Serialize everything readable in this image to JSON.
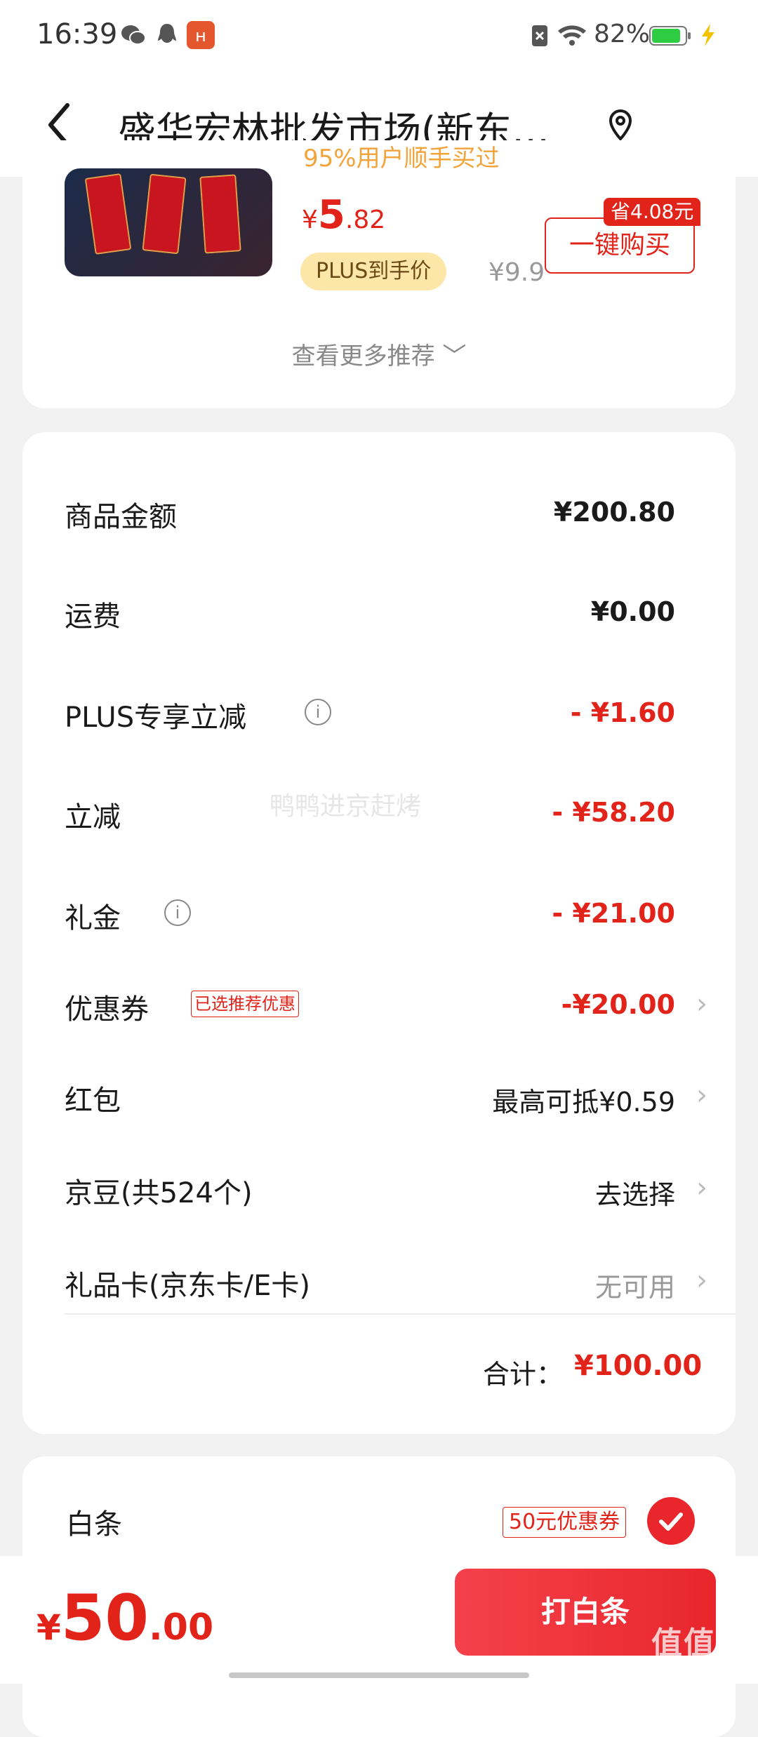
{
  "status_bar": {
    "time": "16:39",
    "battery": "82%"
  },
  "header": {
    "title": "盛华宏林批发市场(新东…"
  },
  "recommend": {
    "sub_text": "95%用户顺手买过",
    "price_symbol": "¥",
    "price_int": "5",
    "price_dec": ".82",
    "plus_label": "PLUS到手价",
    "original_price": "¥9.9",
    "save_badge": "省4.08元",
    "buy_button": "一键购买",
    "more_link": "查看更多推荐 ﹀"
  },
  "price_detail": {
    "rows": [
      {
        "label": "商品金额",
        "value": "¥200.80"
      },
      {
        "label": "运费",
        "value": "¥0.00"
      },
      {
        "label": "PLUS专享立减",
        "value": "- ¥1.60"
      },
      {
        "label": "立减",
        "value": "- ¥58.20"
      },
      {
        "label": "礼金",
        "value": "- ¥21.00"
      },
      {
        "label": "优惠券",
        "tag": "已选推荐优惠",
        "value": "-¥20.00"
      },
      {
        "label": "红包",
        "value": "最高可抵¥0.59"
      },
      {
        "label": "京豆(共524个)",
        "value": "去选择"
      },
      {
        "label": "礼品卡(京东卡/E卡)",
        "value": "无可用"
      }
    ],
    "total_label": "合计：",
    "total_value": "¥100.00",
    "watermark": "鸭鸭进京赶烤"
  },
  "payment": {
    "baitiao_label": "白条",
    "coupon_tag": "50元优惠券",
    "checked": true
  },
  "bottom_bar": {
    "amount_symbol": "¥",
    "amount_int": "50",
    "amount_dec": ".00",
    "pay_button": "打白条"
  },
  "corner_mark": {
    "logo": "值值值",
    "url": "zhizhizhi.com"
  },
  "colors": {
    "accent_red": "#e2231a",
    "plus_gold": "#fde7a8",
    "background": "#f2f2f2"
  }
}
